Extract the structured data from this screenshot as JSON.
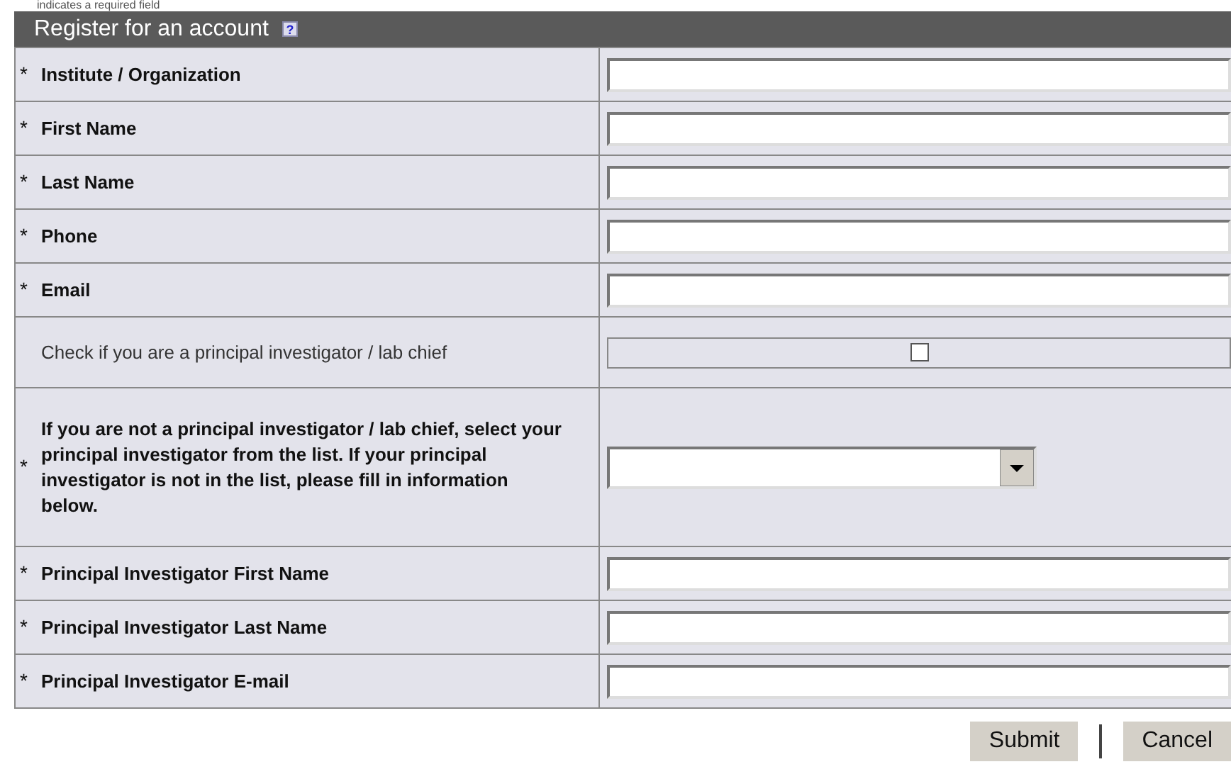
{
  "note": "indicates a required field",
  "form": {
    "title": "Register for an account",
    "help_mark": "?",
    "required_mark": "*",
    "fields": [
      {
        "kind": "text",
        "label": "Institute / Organization",
        "required": true
      },
      {
        "kind": "text",
        "label": "First Name",
        "required": true
      },
      {
        "kind": "text",
        "label": "Last Name",
        "required": true
      },
      {
        "kind": "text",
        "label": "Phone",
        "required": true
      },
      {
        "kind": "text",
        "label": "Email",
        "required": true
      },
      {
        "kind": "checkbox",
        "label": "Check if you are a principal investigator / lab chief",
        "required": false,
        "checked": false
      },
      {
        "kind": "select",
        "label": "If you are not a principal investigator / lab chief, select your principal investigator from the list. If your principal investigator is not in the list, please fill in information below.",
        "required": true
      },
      {
        "kind": "text",
        "label": "Principal Investigator First Name",
        "required": true
      },
      {
        "kind": "text",
        "label": "Principal Investigator Last Name",
        "required": true
      },
      {
        "kind": "text",
        "label": "Principal Investigator E-mail",
        "required": true
      }
    ]
  },
  "buttons": [
    "Submit",
    "Cancel"
  ]
}
